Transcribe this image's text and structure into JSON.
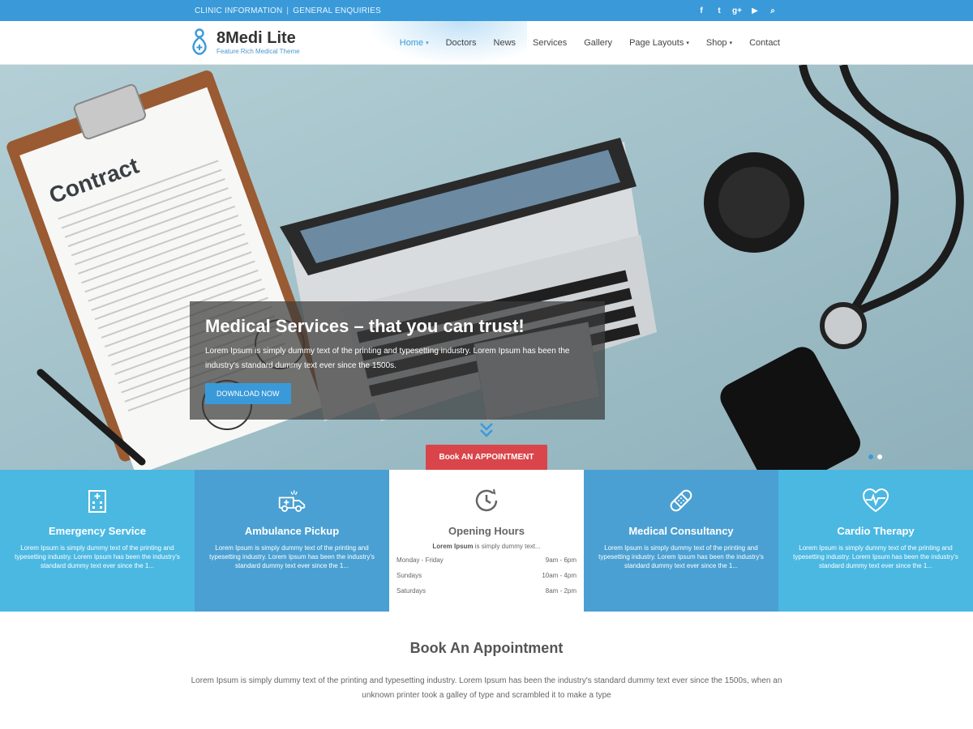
{
  "topbar": {
    "links": [
      "CLINIC INFORMATION",
      "GENERAL ENQUIRIES"
    ],
    "separator": "|",
    "social_icons": [
      "facebook-icon",
      "twitter-icon",
      "google-plus-icon",
      "youtube-icon",
      "search-icon"
    ],
    "social_glyphs": [
      "f",
      "t",
      "g+",
      "▶",
      "⌕"
    ]
  },
  "header": {
    "logo_title": "8Medi Lite",
    "logo_tagline": "Feature Rich Medical Theme",
    "nav": [
      {
        "label": "Home",
        "dropdown": true,
        "active": true
      },
      {
        "label": "Doctors",
        "dropdown": false
      },
      {
        "label": "News",
        "dropdown": false
      },
      {
        "label": "Services",
        "dropdown": false
      },
      {
        "label": "Gallery",
        "dropdown": false
      },
      {
        "label": "Page Layouts",
        "dropdown": true
      },
      {
        "label": "Shop",
        "dropdown": true
      },
      {
        "label": "Contact",
        "dropdown": false
      }
    ],
    "caret": "▾",
    "accent_color": "#3a9ad9"
  },
  "hero": {
    "title": "Medical Services – that you can trust!",
    "text": "Lorem Ipsum is simply dummy text of the printing and typesetting industry. Lorem Ipsum has been the industry's standard dummy text ever since the 1500s.",
    "button": "DOWNLOAD NOW",
    "book_button": "Book AN APPOINTMENT",
    "clipboard_word": "Contract",
    "slide_count": 2,
    "active_slide": 1
  },
  "services": [
    {
      "title": "Emergency Service",
      "icon": "hospital-icon",
      "text": "Lorem Ipsum is simply dummy text of the printing and typesetting industry. Lorem Ipsum has been the industry's standard dummy text ever since the 1..."
    },
    {
      "title": "Ambulance Pickup",
      "icon": "ambulance-icon",
      "text": "Lorem Ipsum is simply dummy text of the printing and typesetting industry. Lorem Ipsum has been the industry's standard dummy text ever since the 1..."
    },
    {
      "title": "Opening Hours",
      "icon": "clock-icon",
      "intro_bold": "Lorem Ipsum",
      "intro_rest": " is simply dummy text...",
      "hours": [
        {
          "day": "Monday - Friday",
          "time": "9am - 6pm"
        },
        {
          "day": "Sundays",
          "time": "10am - 4pm"
        },
        {
          "day": "Saturdays",
          "time": "8am - 2pm"
        }
      ]
    },
    {
      "title": "Medical Consultancy",
      "icon": "bandage-icon",
      "text": "Lorem Ipsum is simply dummy text of the printing and typesetting industry. Lorem Ipsum has been the industry's standard dummy text ever since the 1..."
    },
    {
      "title": "Cardio Therapy",
      "icon": "heartbeat-icon",
      "text": "Lorem Ipsum is simply dummy text of the printing and typesetting industry. Lorem Ipsum has been the industry's standard dummy text ever since the 1..."
    }
  ],
  "appointment": {
    "title": "Book An Appointment",
    "text": "Lorem Ipsum is simply dummy text of the printing and typesetting industry. Lorem Ipsum has been the industry's standard dummy text ever since the 1500s, when an unknown printer took a galley of type and scrambled it to make a type"
  }
}
